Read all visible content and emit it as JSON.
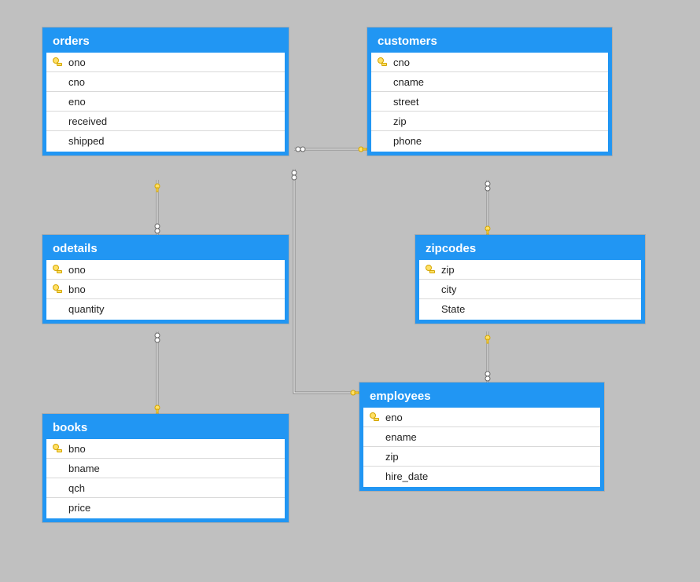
{
  "tables": {
    "orders": {
      "title": "orders",
      "columns": [
        {
          "name": "ono",
          "pk": true
        },
        {
          "name": "cno",
          "pk": false
        },
        {
          "name": "eno",
          "pk": false
        },
        {
          "name": "received",
          "pk": false
        },
        {
          "name": "shipped",
          "pk": false
        }
      ]
    },
    "customers": {
      "title": "customers",
      "columns": [
        {
          "name": "cno",
          "pk": true
        },
        {
          "name": "cname",
          "pk": false
        },
        {
          "name": "street",
          "pk": false
        },
        {
          "name": "zip",
          "pk": false
        },
        {
          "name": "phone",
          "pk": false
        }
      ]
    },
    "odetails": {
      "title": "odetails",
      "columns": [
        {
          "name": "ono",
          "pk": true
        },
        {
          "name": "bno",
          "pk": true
        },
        {
          "name": "quantity",
          "pk": false
        }
      ]
    },
    "zipcodes": {
      "title": "zipcodes",
      "columns": [
        {
          "name": "zip",
          "pk": true
        },
        {
          "name": "city",
          "pk": false
        },
        {
          "name": "State",
          "pk": false
        }
      ]
    },
    "books": {
      "title": "books",
      "columns": [
        {
          "name": "bno",
          "pk": true
        },
        {
          "name": "bname",
          "pk": false
        },
        {
          "name": "qch",
          "pk": false
        },
        {
          "name": "price",
          "pk": false
        }
      ]
    },
    "employees": {
      "title": "employees",
      "columns": [
        {
          "name": "eno",
          "pk": true
        },
        {
          "name": "ename",
          "pk": false
        },
        {
          "name": "zip",
          "pk": false
        },
        {
          "name": "hire_date",
          "pk": false
        }
      ]
    }
  },
  "relationships": [
    {
      "from_table": "orders",
      "from_column": "cno",
      "to_table": "customers",
      "to_column": "cno"
    },
    {
      "from_table": "orders",
      "from_column": "eno",
      "to_table": "employees",
      "to_column": "eno"
    },
    {
      "from_table": "odetails",
      "from_column": "ono",
      "to_table": "orders",
      "to_column": "ono"
    },
    {
      "from_table": "odetails",
      "from_column": "bno",
      "to_table": "books",
      "to_column": "bno"
    },
    {
      "from_table": "customers",
      "from_column": "zip",
      "to_table": "zipcodes",
      "to_column": "zip"
    },
    {
      "from_table": "employees",
      "from_column": "zip",
      "to_table": "zipcodes",
      "to_column": "zip"
    }
  ]
}
